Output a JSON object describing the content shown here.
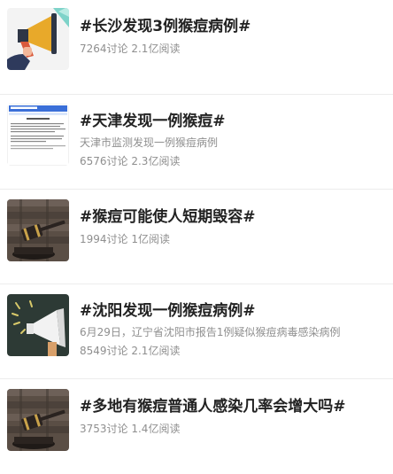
{
  "topics": [
    {
      "title": "#长沙发现3例猴痘病例#",
      "description": "",
      "stats": "7264讨论 2.1亿阅读",
      "thumbnail": "megaphone-icon"
    },
    {
      "title": "#天津发现一例猴痘#",
      "description": "天津市监测发现一例猴痘病例",
      "stats": "6576讨论 2.3亿阅读",
      "thumbnail": "document-icon"
    },
    {
      "title": "#猴痘可能使人短期毁容#",
      "description": "",
      "stats": "1994讨论 1亿阅读",
      "thumbnail": "gavel-icon"
    },
    {
      "title": "#沈阳发现一例猴痘病例#",
      "description": "6月29日，辽宁省沈阳市报告1例疑似猴痘病毒感染病例",
      "stats": "8549讨论 2.1亿阅读",
      "thumbnail": "megaphone-icon"
    },
    {
      "title": "#多地有猴痘普通人感染几率会增大吗#",
      "description": "",
      "stats": "3753讨论 1.4亿阅读",
      "thumbnail": "gavel-icon"
    }
  ]
}
